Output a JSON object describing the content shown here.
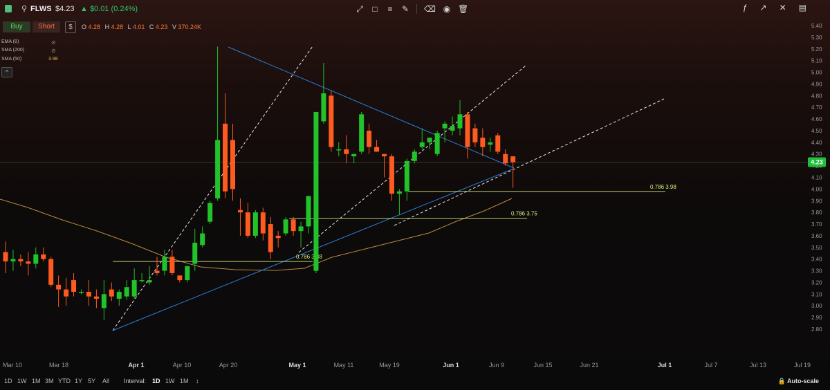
{
  "header": {
    "ticker": "FLWS",
    "price": "$4.23",
    "change": "▲ $0.01 (0.24%)",
    "tools": [
      "pen-line-icon",
      "rectangle-icon",
      "fib-icon",
      "brush-icon",
      "eraser-icon",
      "eye-icon",
      "trash-icon"
    ],
    "right_tools": [
      "formula-icon",
      "chart-up-icon",
      "magnet-icon",
      "expand-icon"
    ]
  },
  "trade": {
    "buy_label": "Buy",
    "short_label": "Short",
    "dollar_label": "$",
    "ohlc": {
      "o_label": "O",
      "o": "4.28",
      "h_label": "H",
      "h": "4.28",
      "l_label": "L",
      "l": "4.01",
      "c_label": "C",
      "c": "4.23",
      "v_label": "V",
      "v": "370.24K"
    }
  },
  "indicators": [
    {
      "name": "EMA (8)",
      "value": ""
    },
    {
      "name": "SMA (200)",
      "value": ""
    },
    {
      "name": "SMA (50)",
      "value": "3.98"
    }
  ],
  "collapse_label": "^",
  "colors": {
    "up": "#22c22a",
    "down": "#ff5a1f",
    "trend": "#2a7fd8",
    "fib": "#d7f07a",
    "sma": "#d9a24a",
    "price_tag": "#1fbf3a"
  },
  "chart_data": {
    "type": "candlestick",
    "y_ticks": [
      "5.40",
      "5.30",
      "5.20",
      "5.10",
      "5.00",
      "4.90",
      "4.80",
      "4.70",
      "4.60",
      "4.50",
      "4.40",
      "4.30",
      "4.20",
      "4.10",
      "4.00",
      "3.90",
      "3.80",
      "3.70",
      "3.60",
      "3.50",
      "3.40",
      "3.30",
      "3.20",
      "3.10",
      "3.00",
      "2.90",
      "2.80"
    ],
    "x_ticks": [
      {
        "label": "Mar 10",
        "bold": false
      },
      {
        "label": "Mar 18",
        "bold": false
      },
      {
        "label": "Apr 1",
        "bold": true
      },
      {
        "label": "Apr 10",
        "bold": false
      },
      {
        "label": "Apr 20",
        "bold": false
      },
      {
        "label": "May 1",
        "bold": true
      },
      {
        "label": "May 11",
        "bold": false
      },
      {
        "label": "May 19",
        "bold": false
      },
      {
        "label": "Jun 1",
        "bold": true
      },
      {
        "label": "Jun 9",
        "bold": false
      },
      {
        "label": "Jun 15",
        "bold": false
      },
      {
        "label": "Jun 21",
        "bold": false
      },
      {
        "label": "Jul 1",
        "bold": true
      },
      {
        "label": "Jul 7",
        "bold": false
      },
      {
        "label": "Jul 13",
        "bold": false
      },
      {
        "label": "Jul 19",
        "bold": false
      }
    ],
    "ylim": [
      2.8,
      5.4
    ],
    "last_price": "4.23",
    "fib_labels": [
      {
        "ratio": "0.786",
        "value": "3.98"
      },
      {
        "ratio": "0.786",
        "value": "3.75"
      },
      {
        "ratio": "0.786",
        "value": "3.38"
      }
    ],
    "candles": [
      {
        "o": 3.46,
        "h": 3.55,
        "l": 3.28,
        "c": 3.38
      },
      {
        "o": 3.38,
        "h": 3.48,
        "l": 3.3,
        "c": 3.4
      },
      {
        "o": 3.4,
        "h": 3.44,
        "l": 3.34,
        "c": 3.38
      },
      {
        "o": 3.38,
        "h": 3.46,
        "l": 3.26,
        "c": 3.36
      },
      {
        "o": 3.36,
        "h": 3.5,
        "l": 3.32,
        "c": 3.44
      },
      {
        "o": 3.44,
        "h": 3.5,
        "l": 3.38,
        "c": 3.4
      },
      {
        "o": 3.4,
        "h": 3.42,
        "l": 3.16,
        "c": 3.18
      },
      {
        "o": 3.18,
        "h": 3.26,
        "l": 2.99,
        "c": 3.14
      },
      {
        "o": 3.14,
        "h": 3.24,
        "l": 3.0,
        "c": 3.08
      },
      {
        "o": 3.22,
        "h": 3.28,
        "l": 3.08,
        "c": 3.12
      },
      {
        "o": 3.12,
        "h": 3.14,
        "l": 3.1,
        "c": 3.12
      },
      {
        "o": 3.12,
        "h": 3.22,
        "l": 3.0,
        "c": 3.08
      },
      {
        "o": 3.08,
        "h": 3.14,
        "l": 2.98,
        "c": 3.06
      },
      {
        "o": 2.98,
        "h": 3.22,
        "l": 2.88,
        "c": 3.1
      },
      {
        "o": 3.14,
        "h": 3.2,
        "l": 3.04,
        "c": 3.08
      },
      {
        "o": 3.06,
        "h": 3.14,
        "l": 3.0,
        "c": 3.12
      },
      {
        "o": 3.08,
        "h": 3.22,
        "l": 3.05,
        "c": 3.16
      },
      {
        "o": 3.08,
        "h": 3.32,
        "l": 3.06,
        "c": 3.22
      },
      {
        "o": 3.22,
        "h": 3.28,
        "l": 3.2,
        "c": 3.22
      },
      {
        "o": 3.2,
        "h": 3.34,
        "l": 3.18,
        "c": 3.22
      },
      {
        "o": 3.3,
        "h": 3.42,
        "l": 3.26,
        "c": 3.28
      },
      {
        "o": 3.3,
        "h": 3.48,
        "l": 3.26,
        "c": 3.42
      },
      {
        "o": 3.42,
        "h": 3.48,
        "l": 3.26,
        "c": 3.28
      },
      {
        "o": 3.26,
        "h": 3.24,
        "l": 3.2,
        "c": 3.22
      },
      {
        "o": 3.22,
        "h": 3.3,
        "l": 3.2,
        "c": 3.34
      },
      {
        "o": 3.36,
        "h": 3.66,
        "l": 3.3,
        "c": 3.54
      },
      {
        "o": 3.52,
        "h": 3.68,
        "l": 3.5,
        "c": 3.62
      },
      {
        "o": 3.72,
        "h": 3.9,
        "l": 3.7,
        "c": 3.88
      },
      {
        "o": 3.92,
        "h": 5.22,
        "l": 3.9,
        "c": 4.42
      },
      {
        "o": 4.56,
        "h": 4.82,
        "l": 3.92,
        "c": 3.98
      },
      {
        "o": 4.42,
        "h": 4.56,
        "l": 3.9,
        "c": 4.0
      },
      {
        "o": 3.82,
        "h": 3.92,
        "l": 3.6,
        "c": 3.8
      },
      {
        "o": 3.8,
        "h": 3.88,
        "l": 3.58,
        "c": 3.6
      },
      {
        "o": 3.6,
        "h": 3.82,
        "l": 3.58,
        "c": 3.8
      },
      {
        "o": 3.8,
        "h": 3.84,
        "l": 3.56,
        "c": 3.62
      },
      {
        "o": 3.7,
        "h": 3.76,
        "l": 3.4,
        "c": 3.46
      },
      {
        "o": 3.6,
        "h": 3.64,
        "l": 3.5,
        "c": 3.58
      },
      {
        "o": 3.62,
        "h": 3.76,
        "l": 3.6,
        "c": 3.74
      },
      {
        "o": 3.74,
        "h": 3.76,
        "l": 3.6,
        "c": 3.64
      },
      {
        "o": 3.64,
        "h": 3.72,
        "l": 3.5,
        "c": 3.68
      },
      {
        "o": 3.68,
        "h": 3.94,
        "l": 3.62,
        "c": 3.94
      },
      {
        "o": 3.3,
        "h": 4.66,
        "l": 3.28,
        "c": 4.66
      },
      {
        "o": 4.58,
        "h": 5.08,
        "l": 4.56,
        "c": 4.82
      },
      {
        "o": 4.8,
        "h": 4.84,
        "l": 4.32,
        "c": 4.36
      },
      {
        "o": 4.34,
        "h": 4.4,
        "l": 4.28,
        "c": 4.34
      },
      {
        "o": 4.34,
        "h": 4.46,
        "l": 4.22,
        "c": 4.3
      },
      {
        "o": 4.28,
        "h": 4.3,
        "l": 4.22,
        "c": 4.3
      },
      {
        "o": 4.32,
        "h": 4.66,
        "l": 4.3,
        "c": 4.64
      },
      {
        "o": 4.5,
        "h": 4.56,
        "l": 4.3,
        "c": 4.36
      },
      {
        "o": 4.36,
        "h": 4.42,
        "l": 4.32,
        "c": 4.32
      },
      {
        "o": 4.3,
        "h": 4.3,
        "l": 4.1,
        "c": 4.28
      },
      {
        "o": 4.28,
        "h": 4.3,
        "l": 3.9,
        "c": 3.96
      },
      {
        "o": 3.96,
        "h": 4.0,
        "l": 3.78,
        "c": 3.98
      },
      {
        "o": 3.98,
        "h": 4.26,
        "l": 3.9,
        "c": 4.24
      },
      {
        "o": 4.24,
        "h": 4.34,
        "l": 4.22,
        "c": 4.32
      },
      {
        "o": 4.36,
        "h": 4.52,
        "l": 4.34,
        "c": 4.4
      },
      {
        "o": 4.4,
        "h": 4.44,
        "l": 4.34,
        "c": 4.44
      },
      {
        "o": 4.3,
        "h": 4.5,
        "l": 4.28,
        "c": 4.48
      },
      {
        "o": 4.52,
        "h": 4.58,
        "l": 4.4,
        "c": 4.56
      },
      {
        "o": 4.5,
        "h": 4.62,
        "l": 4.46,
        "c": 4.54
      },
      {
        "o": 4.52,
        "h": 4.76,
        "l": 4.46,
        "c": 4.64
      },
      {
        "o": 4.64,
        "h": 4.66,
        "l": 4.26,
        "c": 4.36
      },
      {
        "o": 4.52,
        "h": 4.56,
        "l": 4.36,
        "c": 4.4
      },
      {
        "o": 4.44,
        "h": 4.52,
        "l": 4.28,
        "c": 4.36
      },
      {
        "o": 4.38,
        "h": 4.44,
        "l": 4.32,
        "c": 4.4
      },
      {
        "o": 4.46,
        "h": 4.48,
        "l": 4.3,
        "c": 4.32
      },
      {
        "o": 4.3,
        "h": 4.34,
        "l": 4.2,
        "c": 4.22
      },
      {
        "o": 4.28,
        "h": 4.28,
        "l": 4.01,
        "c": 4.23
      }
    ]
  },
  "bottom": {
    "ranges": [
      "1D",
      "1W",
      "1M",
      "3M",
      "YTD",
      "1Y",
      "5Y",
      "All"
    ],
    "interval_label": "Interval:",
    "intervals": [
      "1D",
      "1W",
      "1M"
    ],
    "active_interval": "1D",
    "autoscale_label": "Auto-scale"
  }
}
